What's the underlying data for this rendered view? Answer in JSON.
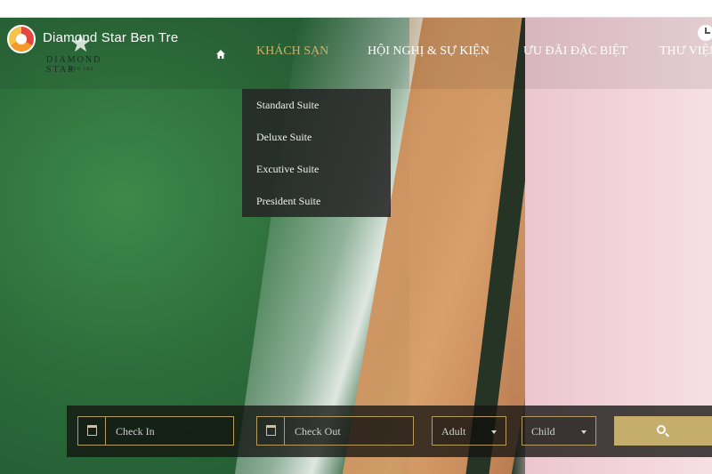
{
  "video": {
    "title": "Diamond Star Ben Tre"
  },
  "brand": {
    "logo_text": "DIAMOND STAR",
    "logo_sub": "BEN TRE"
  },
  "nav": {
    "items": [
      {
        "label": "KHÁCH SẠN"
      },
      {
        "label": "HỘI NGHỊ & SỰ KIỆN"
      },
      {
        "label": "ƯU ĐÃI ĐẶC BIỆT"
      },
      {
        "label": "THƯ VIỆN"
      }
    ],
    "active_color": "#cdb06b"
  },
  "dropdown": {
    "items": [
      "Standard Suite",
      "Deluxe Suite",
      "Excutive Suite",
      "President Suite"
    ]
  },
  "booking": {
    "checkin_placeholder": "Check In",
    "checkout_placeholder": "Check Out",
    "adult_label": "Adult",
    "child_label": "Child",
    "accent_color": "#c5ad6c"
  },
  "icons": {
    "home": "home-icon",
    "calendar": "calendar-icon",
    "search": "search-icon",
    "clock": "clock-icon"
  }
}
